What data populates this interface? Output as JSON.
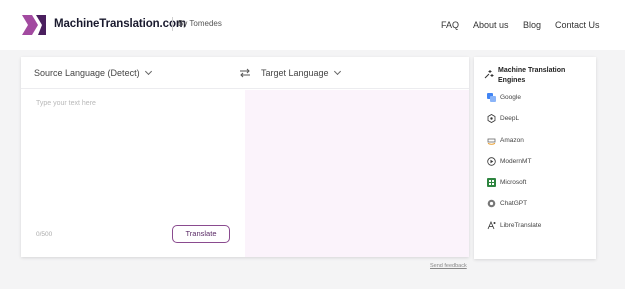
{
  "header": {
    "brand": "MachineTranslation.com",
    "by": "By Tomedes",
    "nav": [
      "FAQ",
      "About us",
      "Blog",
      "Contact Us"
    ]
  },
  "translator": {
    "source_language": "Source Language (Detect)",
    "target_language": "Target Language",
    "placeholder": "Type your text here",
    "counter": "0/500",
    "translate_label": "Translate",
    "feedback_label": "Send feedback"
  },
  "engines": {
    "title": "Machine Translation Engines",
    "items": [
      {
        "label": "Google",
        "icon": "google-icon"
      },
      {
        "label": "DeepL",
        "icon": "deepl-icon"
      },
      {
        "label": "Amazon",
        "icon": "amazon-icon"
      },
      {
        "label": "ModernMT",
        "icon": "modernmt-icon"
      },
      {
        "label": "Microsoft",
        "icon": "microsoft-icon"
      },
      {
        "label": "ChatGPT",
        "icon": "chatgpt-icon"
      },
      {
        "label": "LibreTranslate",
        "icon": "libretranslate-icon"
      }
    ]
  },
  "colors": {
    "accent": "#8a4b8f",
    "logo_purple": "#6b2f7a",
    "target_bg": "#fbf3fb",
    "page_bg": "#f4f4f5"
  }
}
